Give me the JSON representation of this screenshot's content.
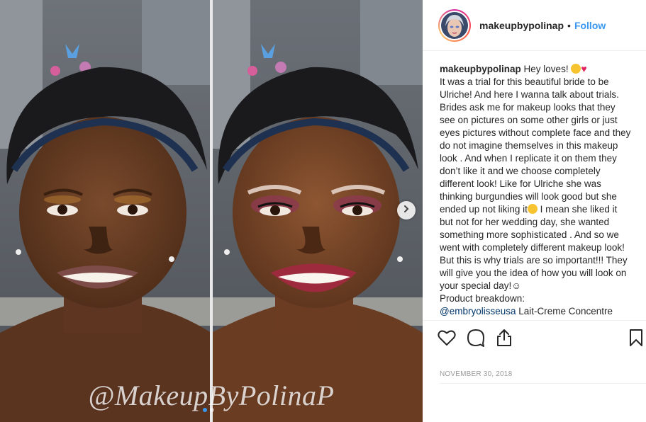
{
  "post": {
    "username": "makeupbypolinap",
    "separator": "•",
    "follow_label": "Follow",
    "caption_greeting": "Hey loves!",
    "caption_body": "It was a trial for this beautiful bride to be Ulriche! And here I wanna talk about trials. Brides ask me for makeup looks that they see on pictures on some other girls or just eyes pictures without complete face and they do not imagine themselves in this makeup look . And when I replicate it on them they don’t like it and we choose completely different look! Like for Ulriche she was thinking burgundies will look good but she ended up not liking it",
    "caption_body2": " I mean she liked it but not for her wedding day, she wanted something more sophisticated . And so we went with completely different makeup look! But this is why trials are so important!!! They will give you the idea of how you will look on your special day!☺",
    "caption_breakdown": "Product breakdown:",
    "mention": "@embryolisseusa",
    "mention_tail": " Lait-Creme Concentre Nourishing Moisturizer",
    "date": "NOVEMBER 30, 2018"
  },
  "media": {
    "watermark": "@MakeupByPolinaP",
    "carousel_index": 1,
    "carousel_count": 2
  },
  "colors": {
    "accent": "#3897f0",
    "text": "#262626",
    "muted": "#999999",
    "border": "#efefef"
  },
  "icons": {
    "next": "chevron-right-icon",
    "like": "heart-icon",
    "comment": "comment-icon",
    "share": "share-icon",
    "save": "bookmark-icon"
  }
}
